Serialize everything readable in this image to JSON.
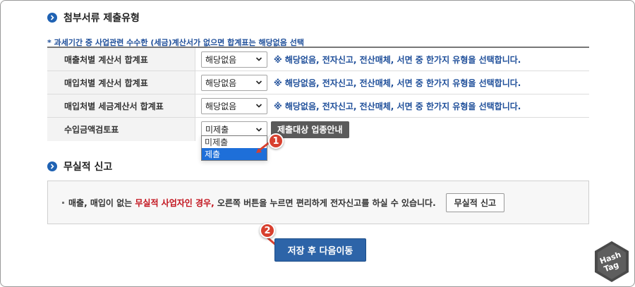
{
  "attachments": {
    "title": "첨부서류 제출유형",
    "note": "* 과세기간 중 사업관련 수수한 (세금)계산서가 없으면 합계표는 해당없음 선택",
    "rows": [
      {
        "label": "매출처별 계산서 합계표",
        "value": "해당없음",
        "hint": "※ 해당없음, 전자신고, 전산매체, 서면 중 한가지 유형을 선택합니다."
      },
      {
        "label": "매입처별 계산서 합계표",
        "value": "해당없음",
        "hint": "※ 해당없음, 전자신고, 전산매체, 서면 중 한가지 유형을 선택합니다."
      },
      {
        "label": "매입처별 세금계산서 합계표",
        "value": "해당없음",
        "hint": "※ 해당없음, 전자신고, 전산매체, 서면 중 한가지 유형을 선택합니다."
      },
      {
        "label": "수입금액검토표",
        "value": "미제출",
        "button": "제출대상 업종안내"
      }
    ],
    "dropdown_options": [
      "미제출",
      "제출"
    ],
    "dropdown_selected": "제출"
  },
  "badges": [
    "1",
    "2"
  ],
  "nil_report": {
    "title": "무실적 신고",
    "text_before": "매출, 매입이 없는 ",
    "text_highlight": "무실적 사업자인 경우,",
    "text_after": " 오른쪽 버튼을 누르면 편리하게 전자신고를 하실 수 있습니다.",
    "button": "무실적 신고"
  },
  "save_button": "저장 후 다음이동",
  "logo": {
    "line1": "Hash",
    "line2": "Tag"
  },
  "colors": {
    "accent": "#1f62b3",
    "primary_button": "#2d64a8",
    "highlight_red": "#c2121c",
    "badge": "#d8402f"
  }
}
